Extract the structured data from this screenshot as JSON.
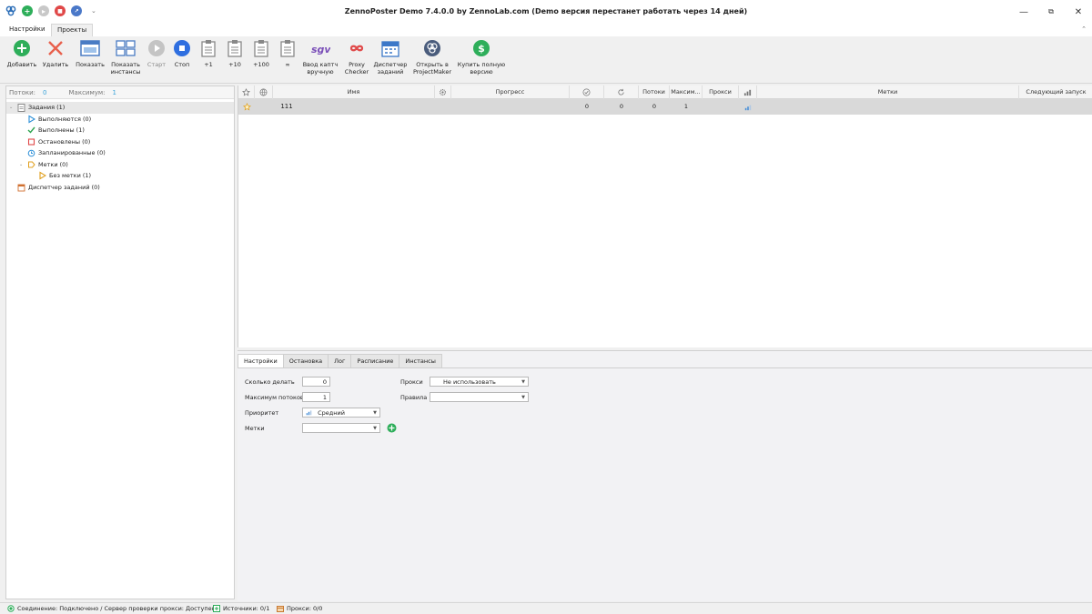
{
  "window": {
    "title": "ZennoPoster Demo 7.4.0.0 by ZennoLab.com (Demo версия перестанет работать через 14 дней)",
    "controls": [
      "—",
      "⧉",
      "✕"
    ]
  },
  "menu": {
    "tabs": [
      "Настройки",
      "Проекты"
    ],
    "active": "Проекты"
  },
  "toolbar": {
    "add": "Добавить",
    "delete": "Удалить",
    "show": "Показать",
    "show_instances": "Показать\nинстансы",
    "start": "Старт",
    "stop": "Стоп",
    "plus1": "+1",
    "plus10": "+10",
    "plus100": "+100",
    "infinity": "∞",
    "captcha": "Ввод каптч\nвручную",
    "proxy_checker": "Proxy\nChecker",
    "task_manager": "Диспетчер\nзаданий",
    "open_projectmaker": "Открыть в\nProjectMaker",
    "buy": "Купить полную\nверсию"
  },
  "left_panel": {
    "threads_label": "Потоки:",
    "threads_value": "0",
    "max_label": "Максимум:",
    "max_value": "1",
    "tree": [
      {
        "label": "Задания (1)",
        "level": 0,
        "icon": "clipboard-icon"
      },
      {
        "label": "Выполняются (0)",
        "level": 1,
        "icon": "play-outline-icon"
      },
      {
        "label": "Выполнены (1)",
        "level": 1,
        "icon": "check-icon"
      },
      {
        "label": "Остановлены (0)",
        "level": 1,
        "icon": "stop-square-icon"
      },
      {
        "label": "Запланированные (0)",
        "level": 1,
        "icon": "clock-icon"
      },
      {
        "label": "Метки (0)",
        "level": 1,
        "icon": "tag-icon"
      },
      {
        "label": "Без метки (1)",
        "level": 2,
        "icon": "play-yellow-icon"
      },
      {
        "label": "Диспетчер заданий (0)",
        "level": 0,
        "icon": "calendar-icon"
      }
    ]
  },
  "grid": {
    "columns": [
      "Имя",
      "Прогресс",
      "Потоки",
      "Максим...",
      "Прокси",
      "Метки",
      "Следующий запуск"
    ],
    "rows": [
      {
        "name": "111",
        "success": "0",
        "fail": "0",
        "threads": "0",
        "max": "1"
      }
    ]
  },
  "settings_panel": {
    "tabs": [
      "Настройки",
      "Остановка",
      "Лог",
      "Расписание",
      "Инстансы"
    ],
    "active_tab": "Настройки",
    "how_many_label": "Сколько делать",
    "how_many_value": "0",
    "max_threads_label": "Максимум потоков",
    "max_threads_value": "1",
    "priority_label": "Приоритет",
    "priority_value": "Средний",
    "labels_label": "Метки",
    "labels_value": "",
    "proxy_label": "Прокси",
    "proxy_value": "Не использовать",
    "rules_label": "Правила",
    "rules_value": ""
  },
  "status_bar": {
    "connection": "Соединение: Подключено / Сервер проверки прокси: Доступен",
    "sources": "Источники: 0/1",
    "proxies": "Прокси: 0/0"
  }
}
